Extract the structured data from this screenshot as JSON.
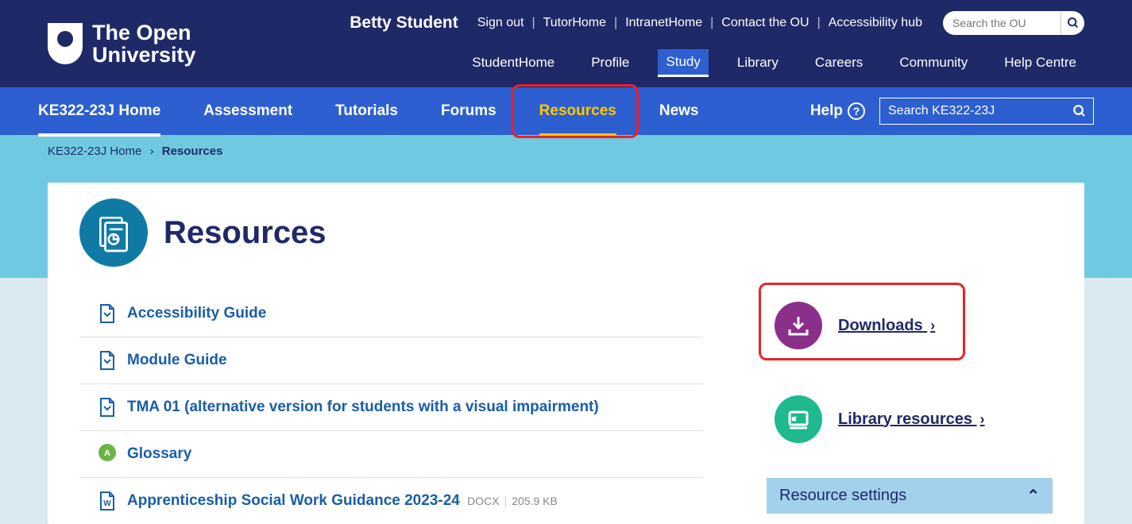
{
  "header": {
    "logo_line1": "The Open",
    "logo_line2": "University",
    "user_name": "Betty Student",
    "top_links": [
      "Sign out",
      "TutorHome",
      "IntranetHome",
      "Contact the OU",
      "Accessibility hub"
    ],
    "search_placeholder": "Search the OU",
    "main_nav": [
      "StudentHome",
      "Profile",
      "Study",
      "Library",
      "Careers",
      "Community",
      "Help Centre"
    ],
    "main_nav_active": "Study"
  },
  "module_nav": {
    "items": [
      "KE322-23J Home",
      "Assessment",
      "Tutorials",
      "Forums",
      "Resources",
      "News"
    ],
    "active": "Resources",
    "help_label": "Help",
    "search_placeholder": "Search KE322-23J"
  },
  "breadcrumb": {
    "home": "KE322-23J Home",
    "current": "Resources"
  },
  "page": {
    "title": "Resources"
  },
  "resources": [
    {
      "label": "Accessibility Guide",
      "type": "doc"
    },
    {
      "label": "Module Guide",
      "type": "doc"
    },
    {
      "label": "TMA 01 (alternative version for students with a visual impairment)",
      "type": "doc"
    },
    {
      "label": "Glossary",
      "type": "glossary"
    },
    {
      "label": "Apprenticeship Social Work Guidance 2023-24",
      "type": "word",
      "ext": "DOCX",
      "size": "205.9 KB"
    }
  ],
  "side": {
    "downloads": "Downloads",
    "library": "Library resources",
    "settings": "Resource settings"
  }
}
